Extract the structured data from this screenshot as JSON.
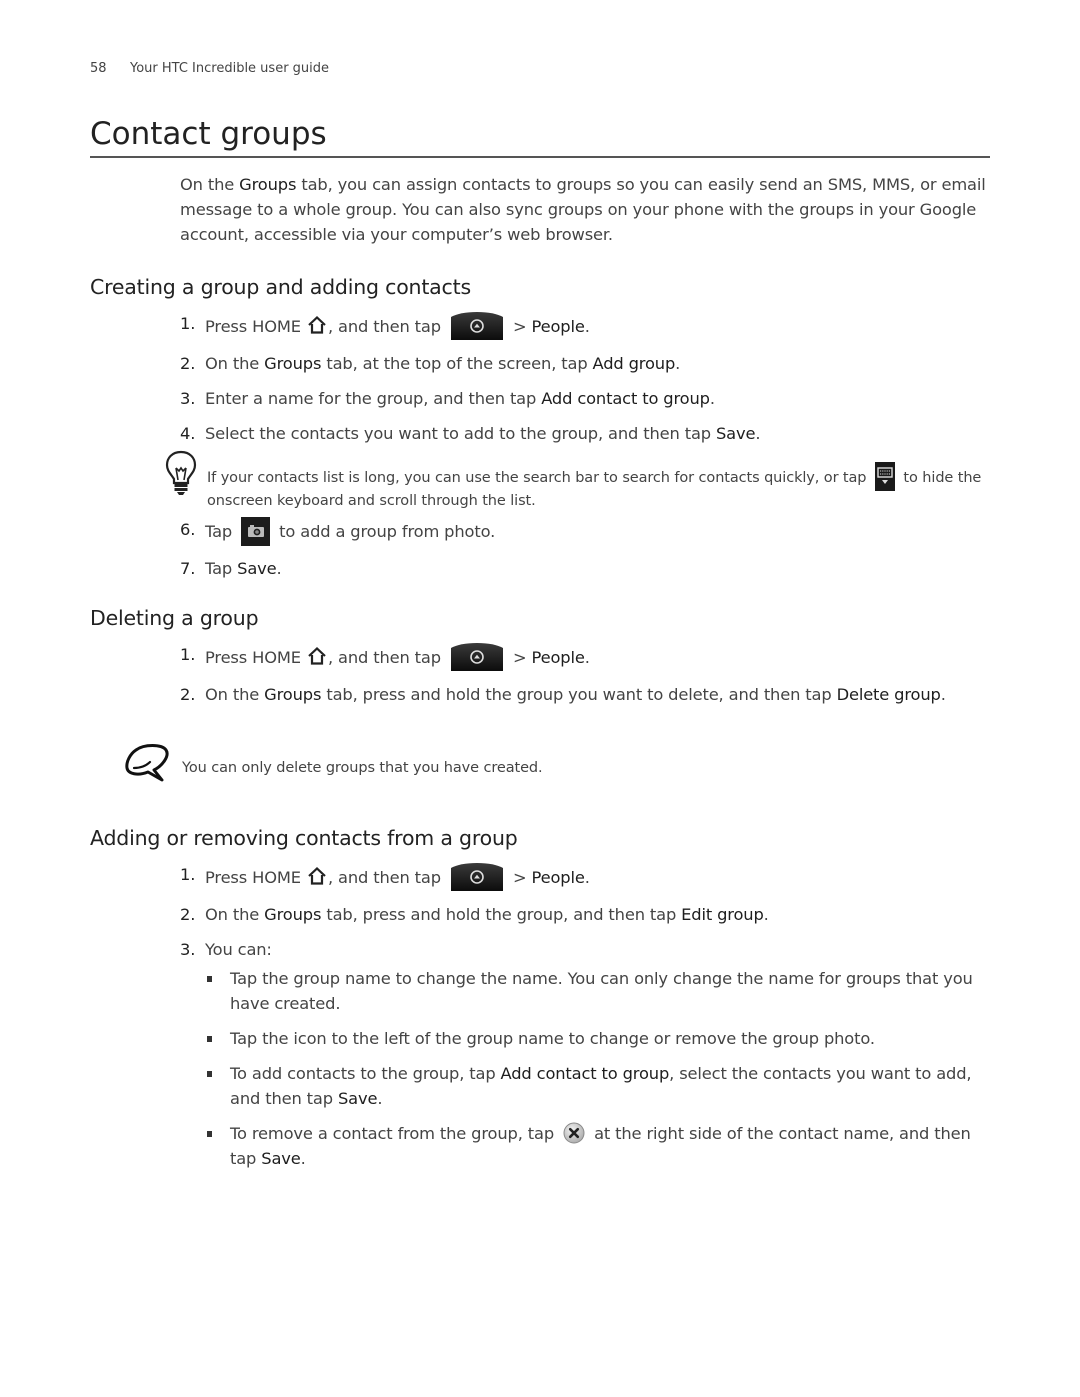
{
  "header": {
    "page_number": "58",
    "guide_title": "Your HTC Incredible user guide"
  },
  "title": "Contact groups",
  "intro": {
    "t1": "On the ",
    "groups": "Groups",
    "t2": " tab, you can assign contacts to groups so you can easily send an SMS, MMS, or email message to a whole group. You can also sync groups on your phone with the groups in your Google account, accessible via your computer’s web browser."
  },
  "icons": {
    "home": "home-icon",
    "all_apps": "all-apps-button-icon",
    "keyboard": "hide-keyboard-icon",
    "camera": "camera-icon",
    "remove": "remove-x-icon",
    "tip": "lightbulb-tip-icon",
    "note": "speech-bubble-note-icon"
  },
  "sections": {
    "creating": {
      "heading": "Creating a group and adding contacts",
      "steps": [
        {
          "num": "1.",
          "t1": "Press HOME ",
          "t2": ", and then tap ",
          "t3": " > ",
          "hl1": "People",
          "t4": "."
        },
        {
          "num": "2.",
          "t1": "On the ",
          "hl1": "Groups",
          "t2": " tab, at the top of the screen, tap ",
          "hl2": "Add group",
          "t3": "."
        },
        {
          "num": "3.",
          "t1": "Enter a name for the group, and then tap ",
          "hl1": "Add contact to group",
          "t2": "."
        },
        {
          "num": "4.",
          "t1": "Select the contacts you want to add to the group, and then tap ",
          "hl1": "Save",
          "t2": "."
        },
        {
          "num": "6.",
          "t1": "Tap ",
          "t2": " to add a group from photo."
        },
        {
          "num": "7.",
          "t1": "Tap ",
          "hl1": "Save",
          "t2": "."
        }
      ],
      "tip": {
        "t1": "If your contacts list is long, you can use the search bar to search for contacts quickly, or tap ",
        "t2": " to hide the onscreen keyboard and scroll through the list."
      }
    },
    "deleting": {
      "heading": "Deleting a group",
      "steps": [
        {
          "num": "1.",
          "t1": "Press HOME ",
          "t2": ", and then tap ",
          "t3": " > ",
          "hl1": "People",
          "t4": "."
        },
        {
          "num": "2.",
          "t1": "On the ",
          "hl1": "Groups",
          "t2": " tab, press and hold the group you want to delete, and then tap ",
          "hl2": "Delete group",
          "t3": "."
        }
      ],
      "note": "You can only delete groups that you have created."
    },
    "editing": {
      "heading": "Adding or removing contacts from a group",
      "steps": [
        {
          "num": "1.",
          "t1": "Press HOME ",
          "t2": ", and then tap ",
          "t3": " > ",
          "hl1": "People",
          "t4": "."
        },
        {
          "num": "2.",
          "t1": "On the ",
          "hl1": "Groups",
          "t2": " tab, press and hold the group, and then tap ",
          "hl2": "Edit group",
          "t3": "."
        },
        {
          "num": "3.",
          "t1": "You can:"
        }
      ],
      "bullets": [
        {
          "t1": "Tap the group name to change the name. You can only change the name for groups that you have created."
        },
        {
          "t1": "Tap the icon to the left of the group name to change or remove the group photo."
        },
        {
          "t1": "To add contacts to the group, tap ",
          "hl1": "Add contact to group",
          "t2": ", select the contacts you want to add, and then tap ",
          "hl2": "Save",
          "t3": "."
        },
        {
          "t1": "To remove a contact from the group, tap ",
          "t2": " at the right side of the contact name, and then tap ",
          "hl1": "Save",
          "t3": "."
        }
      ]
    }
  }
}
